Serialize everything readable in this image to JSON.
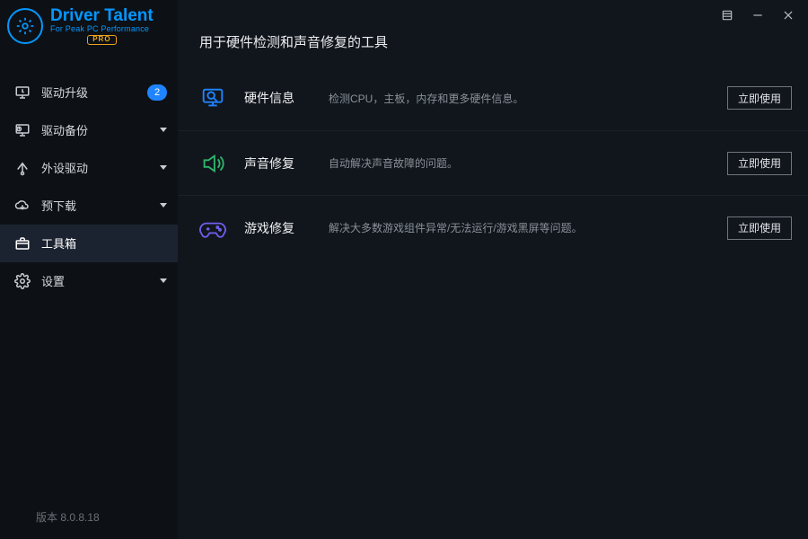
{
  "app": {
    "name_line1": "Driver Talent",
    "name_line2": "For Peak PC Performance",
    "pro_label": "PRO"
  },
  "sidebar": {
    "items": [
      {
        "label": "驱动升级",
        "badge": "2"
      },
      {
        "label": "驱动备份"
      },
      {
        "label": "外设驱动"
      },
      {
        "label": "预下载"
      },
      {
        "label": "工具箱"
      },
      {
        "label": "设置"
      }
    ]
  },
  "main": {
    "heading": "用于硬件检测和声音修复的工具",
    "tools": [
      {
        "name": "硬件信息",
        "desc": "检测CPU，主板，内存和更多硬件信息。",
        "action": "立即使用"
      },
      {
        "name": "声音修复",
        "desc": "自动解决声音故障的问题。",
        "action": "立即使用"
      },
      {
        "name": "游戏修复",
        "desc": "解决大多数游戏组件异常/无法运行/游戏黑屏等问题。",
        "action": "立即使用"
      }
    ]
  },
  "footer": {
    "version": "版本 8.0.8.18"
  },
  "colors": {
    "accent": "#0597ff",
    "sidebar_bg": "#0d1116",
    "panel_bg": "#11161d",
    "green": "#2fb56a",
    "purple": "#6e5ff0"
  }
}
